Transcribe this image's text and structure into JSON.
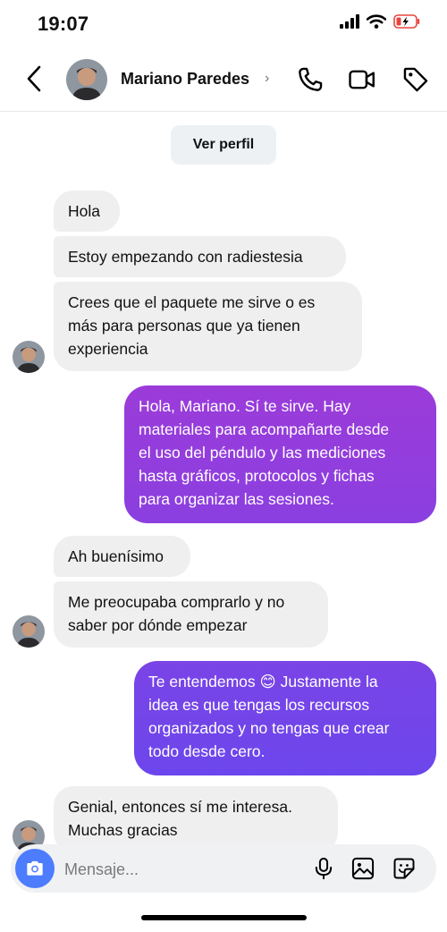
{
  "status_bar": {
    "time": "19:07",
    "icons": [
      "cellular-signal-icon",
      "wifi-icon",
      "battery-charging-icon"
    ],
    "battery_color": "#e8453c"
  },
  "header": {
    "contact_name": "Mariano Paredes",
    "chevron": "›",
    "icons": [
      "back-chevron-icon",
      "phone-icon",
      "video-camera-icon",
      "tag-icon"
    ]
  },
  "chat": {
    "ver_perfil_label": "Ver perfil",
    "messages": [
      {
        "from": "contact",
        "text": "Hola"
      },
      {
        "from": "contact",
        "text": "Estoy empezando con radiestesia"
      },
      {
        "from": "contact",
        "text": "Crees que el paquete me sirve o es\nmás para personas que ya tienen\nexperiencia"
      },
      {
        "from": "me",
        "text": "Hola, Mariano. Sí te sirve. Hay\nmateriales para acompañarte desde\nel uso del péndulo y las mediciones\nhasta gráficos, protocolos y fichas\npara organizar las sesiones."
      },
      {
        "from": "contact",
        "text": "Ah buenísimo"
      },
      {
        "from": "contact",
        "text": "Me preocupaba comprarlo y no\nsaber por dónde empezar"
      },
      {
        "from": "me",
        "text": "Te entendemos 😊 Justamente la\nidea es que tengas los recursos\norganizados y no tengas que crear\ntodo desde cero."
      },
      {
        "from": "contact",
        "text": "Genial, entonces sí me interesa.\nMuchas gracias"
      }
    ],
    "colors": {
      "incoming_bubble": "#efefef",
      "outgoing_gradient_1": "#9a3bd9",
      "outgoing_gradient_2": "#6f45ec"
    }
  },
  "composer": {
    "placeholder": "Mensaje...",
    "icons": [
      "camera-icon",
      "microphone-icon",
      "gallery-icon",
      "sticker-icon"
    ],
    "camera_button_color": "#4d7cfe"
  }
}
